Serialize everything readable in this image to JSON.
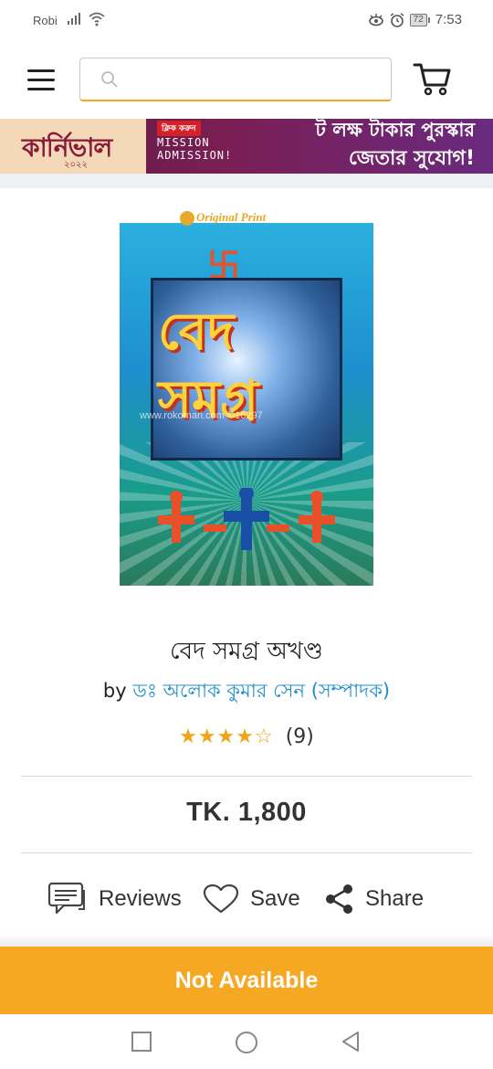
{
  "status_bar": {
    "carrier": "Robi",
    "battery": "72",
    "time": "7:53"
  },
  "header": {
    "search_placeholder": ""
  },
  "banner": {
    "logo_text": "কার্নিভাল",
    "year": "২০২২",
    "tag": "ক্লিক করুন",
    "mission_line1": "MISSION",
    "mission_line2": "ADMISSION!",
    "right_line1": "ট লক্ষ টাকার পুরস্কার",
    "right_line2": "জেতার সুযোগ!"
  },
  "cover": {
    "badge": "Original Print",
    "title_line1": "বেদ",
    "title_line2": "সমগ্র",
    "watermark": "www.rokomari.com  ©16297"
  },
  "book": {
    "title": "বেদ সমগ্র অখণ্ড",
    "by_prefix": "by",
    "author": "ডঃ অলোক কুমার সেন (সম্পাদক)",
    "stars": "★★★★☆",
    "rating_count": "(9)",
    "price": "TK. 1,800"
  },
  "actions": {
    "reviews": "Reviews",
    "save": "Save",
    "share": "Share"
  },
  "cta": {
    "label": "Not Available"
  },
  "colors": {
    "accent": "#f7a823",
    "link": "#1f8ec9",
    "star": "#f0a419"
  }
}
